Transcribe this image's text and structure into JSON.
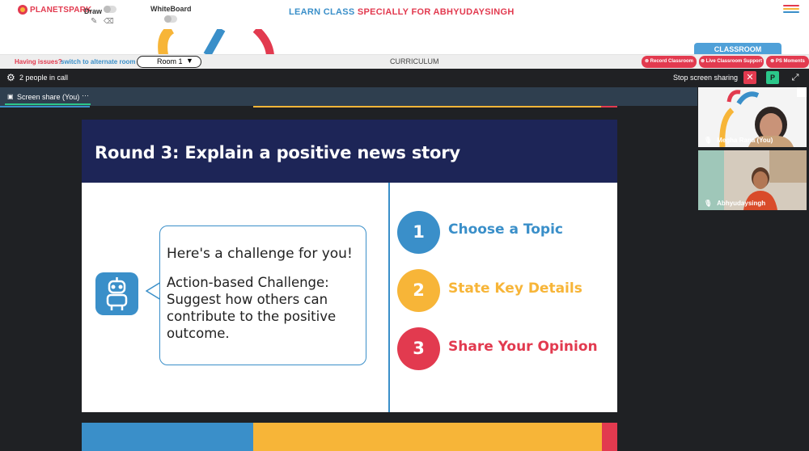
{
  "app": {
    "logo_text": "PLANETSPARK",
    "title_part1": "LEARN CLASS",
    "title_part2": "SPECIALLY FOR ABHYUDAYSINGH"
  },
  "top_controls": {
    "draw_label": "Draw",
    "whiteboard_label": "WhiteBoard"
  },
  "classroom_tab": "CLASSROOM",
  "toolbar": {
    "issue_text": "Having issues?",
    "issue_link": "switch to alternate room",
    "room_value": "Room 1",
    "room_chevron": "▼",
    "curriculum_label": "CURRICULUM",
    "buttons": [
      "Record Classroom",
      "Live Classroom Support",
      "PS Moments"
    ]
  },
  "meeting": {
    "people_count": "2 people in call",
    "stop_sharing": "Stop screen sharing",
    "stop_icon": "✕",
    "p_button": "P",
    "share_label": "Screen share (You)",
    "share_more": "···"
  },
  "slide": {
    "title": "Round 3: Explain a positive news story",
    "bubble_line1": "Here's a challenge for you!",
    "bubble_line2": "Action-based Challenge: Suggest how others can contribute to the positive outcome.",
    "steps": [
      {
        "number": "1",
        "label": "Choose a Topic",
        "color": "#3a8fc9"
      },
      {
        "number": "2",
        "label": "State Key Details",
        "color": "#f7b538"
      },
      {
        "number": "3",
        "label": "Share Your Opinion",
        "color": "#e23a4f"
      }
    ]
  },
  "participants": [
    {
      "name": "Megha Rana (You)"
    },
    {
      "name": "Abhyudaysingh"
    }
  ],
  "colors": {
    "brand_red": "#e23a4f",
    "brand_blue": "#3a8fc9",
    "brand_yellow": "#f7b538",
    "slide_header": "#1d2557",
    "meet_bg": "#1f2124",
    "share_bar": "#2f3f4f",
    "green": "#2bc78a"
  }
}
